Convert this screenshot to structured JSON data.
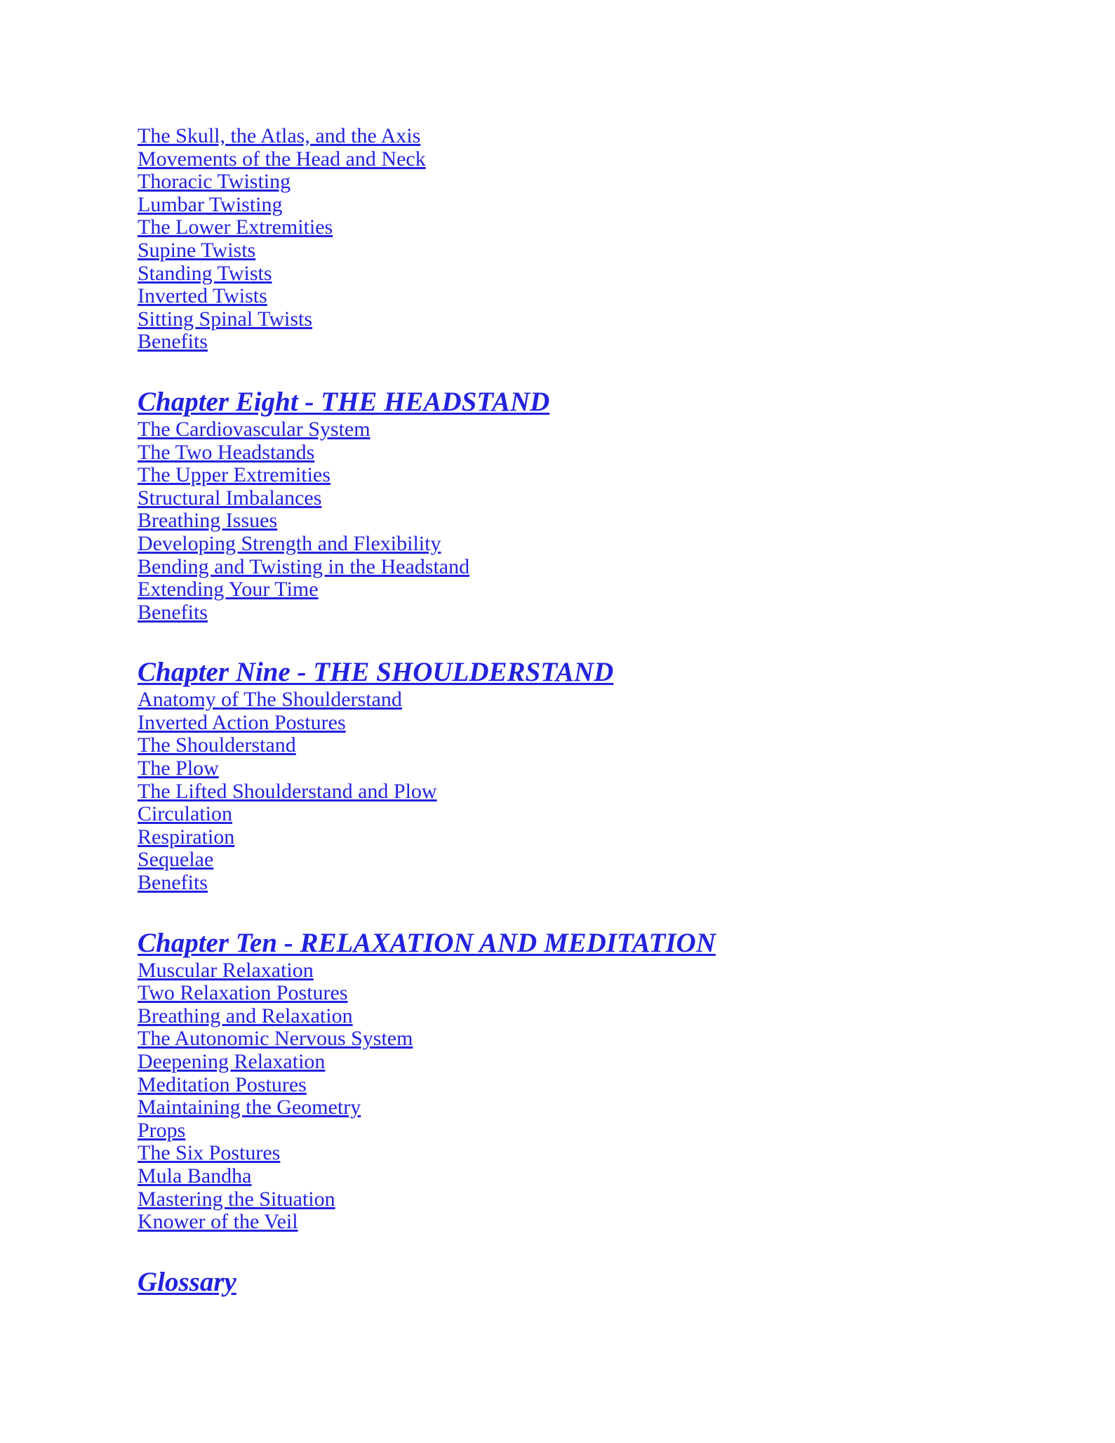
{
  "page": {
    "background_color": "#ffffff",
    "link_color": "#2222dd",
    "document_type": "table-of-contents"
  },
  "toc": {
    "continued_entries": [
      "The Skull, the Atlas, and the Axis",
      "Movements of the Head and Neck",
      "Thoracic Twisting",
      "Lumbar Twisting",
      "The Lower Extremities",
      "Supine Twists",
      "Standing Twists",
      "Inverted Twists",
      "Sitting Spinal Twists",
      "Benefits"
    ],
    "chapters": [
      {
        "heading": "Chapter Eight - THE HEADSTAND",
        "entries": [
          "The Cardiovascular System",
          "The Two Headstands",
          "The Upper Extremities",
          "Structural Imbalances",
          "Breathing Issues",
          "Developing Strength and Flexibility",
          "Bending and Twisting in the Headstand",
          "Extending Your Time",
          "Benefits"
        ]
      },
      {
        "heading": "Chapter Nine - THE SHOULDERSTAND",
        "entries": [
          "Anatomy of The Shoulderstand",
          "Inverted Action Postures",
          "The Shoulderstand",
          "The Plow",
          "The Lifted Shoulderstand and Plow",
          "Circulation",
          "Respiration",
          "Sequelae",
          "Benefits"
        ]
      },
      {
        "heading": "Chapter Ten - RELAXATION AND MEDITATION",
        "entries": [
          "Muscular Relaxation",
          "Two Relaxation Postures",
          "Breathing and Relaxation",
          "The Autonomic Nervous System",
          "Deepening Relaxation",
          "Meditation Postures",
          "Maintaining the Geometry",
          "Props",
          "The Six Postures",
          "Mula Bandha",
          "Mastering the Situation",
          "Knower of the Veil"
        ]
      }
    ],
    "glossary_heading": "Glossary"
  }
}
